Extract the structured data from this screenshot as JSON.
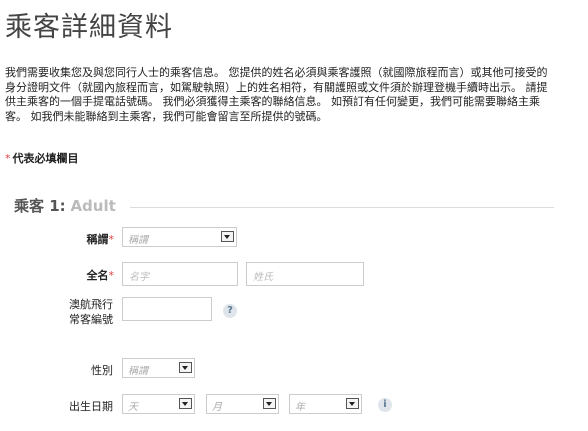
{
  "page": {
    "title": "乘客詳細資料",
    "intro": "我們需要收集您及與您同行人士的乘客信息。 您提供的姓名必須與乘客護照（就國際旅程而言）或其他可接受的身分證明文件（就國內旅程而言，如駕駛執照）上的姓名相符，有關護照或文件須於辦理登機手續時出示。 請提供主乘客的一個手提電話號碼。 我們必須獲得主乘客的聯絡信息。 如預訂有任何變更，我們可能需要聯絡主乘客。 如我們未能聯絡到主乘客，我們可能會留言至所提供的號碼。",
    "required_star": "*",
    "required_note": "代表必填欄目"
  },
  "passenger": {
    "section_num": "乘客 1:",
    "section_type": "Adult",
    "title_label": "稱謂",
    "title_star": "*",
    "title_placeholder": "稱謂",
    "name_label": "全名",
    "name_star": "*",
    "first_name_placeholder": "名字",
    "last_name_placeholder": "姓氏",
    "ff_label_line1": "澳航飛行",
    "ff_label_line2": "常客編號",
    "ff_value": "",
    "help_icon": "?",
    "gender_label": "性別",
    "gender_placeholder": "稱謂",
    "dob_label": "出生日期",
    "day_placeholder": "天",
    "month_placeholder": "月",
    "year_placeholder": "年",
    "info_icon": "i"
  }
}
